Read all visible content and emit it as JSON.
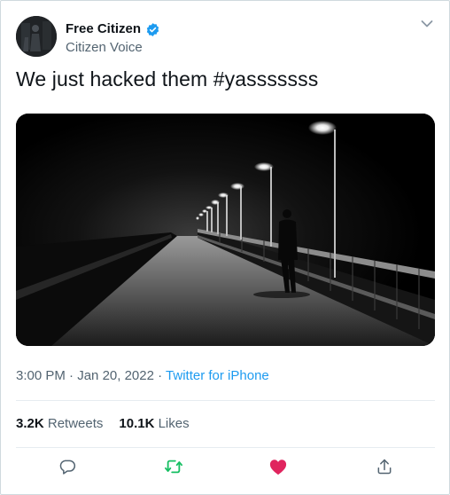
{
  "author": {
    "display_name": "Free Citizen",
    "handle": "Citizen Voice",
    "verified": true
  },
  "tweet": {
    "text": "We just hacked them #yasssssss",
    "time": "3:00 PM",
    "separator": "·",
    "date": "Jan 20, 2022",
    "source": "Twitter for iPhone"
  },
  "stats": {
    "retweets_count": "3.2K",
    "retweets_label": "Retweets",
    "likes_count": "10.1K",
    "likes_label": "Likes"
  },
  "icons": {
    "reply": "reply-icon",
    "retweet": "retweet-icon",
    "like": "heart-icon",
    "share": "share-icon",
    "menu": "chevron-down-icon",
    "verified": "verified-badge-icon"
  },
  "colors": {
    "text": "#0f1419",
    "secondary": "#536471",
    "link": "#1d9bf0",
    "retweet_active": "#17bf63",
    "like_active": "#e0245e",
    "border": "#cfd9de"
  }
}
